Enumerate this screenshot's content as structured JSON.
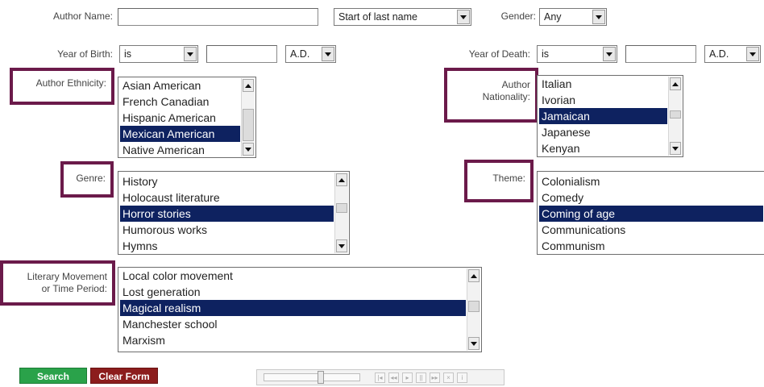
{
  "author_name": {
    "label": "Author Name:",
    "value": "",
    "match_select": "Start of last name"
  },
  "gender": {
    "label": "Gender:",
    "value": "Any"
  },
  "birth": {
    "label": "Year of Birth:",
    "op": "is",
    "year": "",
    "era": "A.D."
  },
  "death": {
    "label": "Year of Death:",
    "op": "is",
    "year": "",
    "era": "A.D."
  },
  "ethnicity": {
    "label": "Author Ethnicity:",
    "options": [
      "Asian American",
      "French Canadian",
      "Hispanic American",
      "Mexican American",
      "Native American"
    ],
    "selected": "Mexican American"
  },
  "nationality": {
    "label_line1": "Author",
    "label_line2": "Nationality:",
    "options": [
      "Italian",
      "Ivorian",
      "Jamaican",
      "Japanese",
      "Kenyan"
    ],
    "selected": "Jamaican"
  },
  "genre": {
    "label": "Genre:",
    "options": [
      "History",
      "Holocaust literature",
      "Horror stories",
      "Humorous works",
      "Hymns"
    ],
    "selected": "Horror stories"
  },
  "theme": {
    "label": "Theme:",
    "options": [
      "Colonialism",
      "Comedy",
      "Coming of age",
      "Communications",
      "Communism"
    ],
    "selected": "Coming of age"
  },
  "movement": {
    "label_line1": "Literary Movement",
    "label_line2": "or Time Period:",
    "options": [
      "Local color movement",
      "Lost generation",
      "Magical realism",
      "Manchester school",
      "Marxism"
    ],
    "selected": "Magical realism"
  },
  "buttons": {
    "search": "Search",
    "clear": "Clear Form"
  },
  "colors": {
    "highlight_border": "#6b1a4a",
    "selection": "#0e2260",
    "search_bg": "#2aa24a",
    "clear_bg": "#8c1d1d"
  }
}
